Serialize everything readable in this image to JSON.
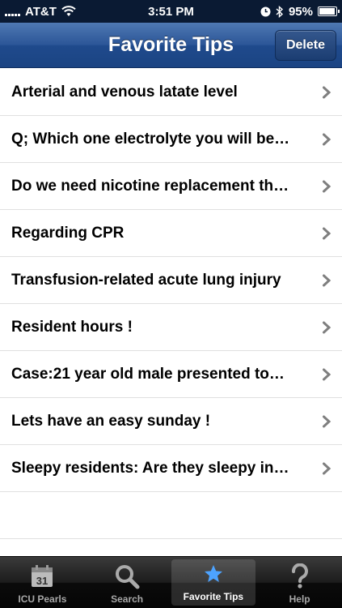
{
  "status_bar": {
    "carrier": "AT&T",
    "time": "3:51 PM",
    "battery": "95%",
    "battery_level": 0.95
  },
  "nav": {
    "title": "Favorite Tips",
    "delete_label": "Delete"
  },
  "tips": [
    "Arterial and venous latate level",
    "Q; Which one electrolyte you will be…",
    "Do we need nicotine replacement th…",
    "Regarding CPR",
    "Transfusion-related acute lung injury",
    "Resident hours !",
    "Case:21 year old male presented to…",
    "Lets have an easy sunday !",
    "Sleepy residents: Are they sleepy in…"
  ],
  "tabs": [
    {
      "label": "ICU Pearls",
      "icon": "calendar-icon",
      "calendar_day": "31"
    },
    {
      "label": "Search",
      "icon": "magnifier-icon"
    },
    {
      "label": "Favorite Tips",
      "icon": "star-icon",
      "active": true
    },
    {
      "label": "Help",
      "icon": "question-icon"
    }
  ],
  "colors": {
    "nav_blue": "#2b5597",
    "active_star": "#4da3ff",
    "chevron": "#7f7f7f"
  }
}
